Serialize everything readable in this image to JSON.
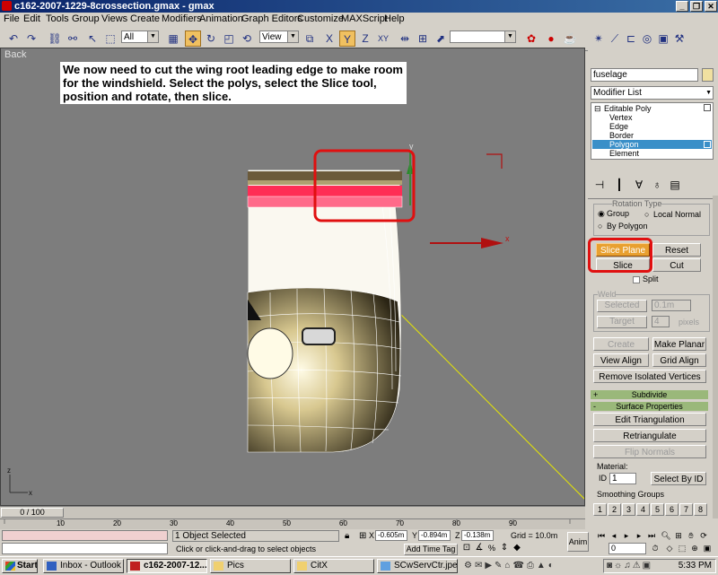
{
  "title_bar": {
    "title": "c162-2007-1229-8crossection.gmax - gmax"
  },
  "menu": [
    "File",
    "Edit",
    "Tools",
    "Group",
    "Views",
    "Create",
    "Modifiers",
    "Animation",
    "Graph Editors",
    "Customize",
    "MAXScript",
    "Help"
  ],
  "toolbar": {
    "selection_filter": "All",
    "coordinate_system": "View"
  },
  "viewport": {
    "label": "Back",
    "instruction_note": "We now need to cut the wing root leading edge to make room for the windshield.  Select the polys, select the Slice tool, position and rotate, then slice.",
    "gizmo_x_label": "x",
    "gizmo_y_label": "y",
    "axis_tripod": {
      "x": "x",
      "z": "z"
    }
  },
  "command_panel": {
    "object_name": "fuselage",
    "modifier_list_label": "Modifier List",
    "modifier_stack": {
      "root": "Editable Poly",
      "subobjects": [
        "Vertex",
        "Edge",
        "Border",
        "Polygon",
        "Element"
      ],
      "selected": "Polygon"
    },
    "rollout_header_partial": "Rotation Type",
    "radio_group": "Group",
    "radio_local_normal": "Local Normal",
    "radio_by_polygon": "By Polygon",
    "slice_plane_label": "Slice Plane",
    "reset_plane_label": "Reset Plane",
    "slice_label": "Slice",
    "cut_label": "Cut",
    "split_label": "Split",
    "weld_group": "Weld",
    "weld_selected_label": "Selected",
    "weld_selected_value": "0.1m",
    "weld_target_label": "Target",
    "weld_target_value": "4",
    "weld_pixels": "pixels",
    "create_shape_label": "Create Shape",
    "make_planar_label": "Make Planar",
    "view_align_label": "View Align",
    "grid_align_label": "Grid Align",
    "remove_isolated_label": "Remove Isolated Vertices",
    "subdivide_rollout": "Subdivide",
    "surface_properties_rollout": "Surface Properties",
    "edit_triangulation_label": "Edit Triangulation",
    "retriangulate_label": "Retriangulate",
    "flip_normals_label": "Flip Normals",
    "material_label": "Material:",
    "material_id_label": "ID",
    "material_id_value": "1",
    "select_by_id_label": "Select By ID",
    "smoothing_groups_label": "Smoothing Groups",
    "smoothing_numbers": [
      "1",
      "2",
      "3",
      "4",
      "5",
      "6",
      "7",
      "8"
    ]
  },
  "time_slider": {
    "frame_display": "0 / 100"
  },
  "track_bar": {
    "ticks": [
      "10",
      "20",
      "30",
      "40",
      "50",
      "60",
      "70",
      "80",
      "90"
    ]
  },
  "status": {
    "selection_info": "1 Object Selected",
    "prompt": "Click or click-and-drag to select objects",
    "x_value": "-0.605m",
    "y_value": "-0.894m",
    "z_value": "-0.138m",
    "grid": "Grid = 10.0m",
    "add_time_tag": "Add Time Tag",
    "anim_label": "Anim",
    "frame_value": "0"
  },
  "taskbar": {
    "start": "Start",
    "tasks": [
      "Inbox - Outlook ...",
      "c162-2007-12...",
      "Pics",
      "CitX",
      "SCwServCtr.jpe..."
    ],
    "active_task": "c162-2007-12...",
    "clock": "5:33 PM"
  },
  "colors": {
    "highlight_red": "#e01010",
    "selected_polys": "#ff4d7a",
    "wing_body": "#6b5a3a",
    "gizmo_yellow": "#e8e800"
  }
}
